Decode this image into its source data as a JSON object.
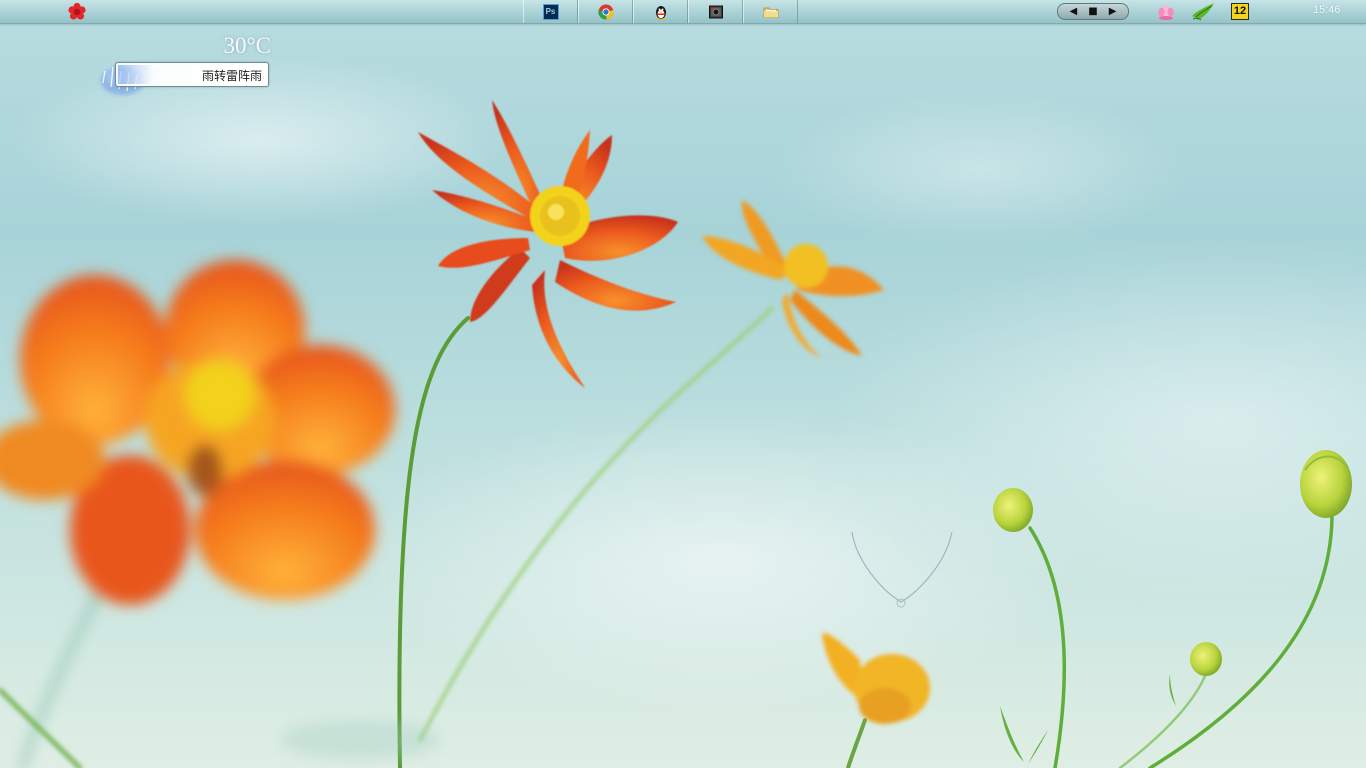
{
  "taskbar": {
    "start_icon": "red-flower-icon",
    "task_buttons": [
      {
        "name": "photoshop",
        "icon": "photoshop-icon",
        "label": "Ps"
      },
      {
        "name": "chrome",
        "icon": "chrome-icon"
      },
      {
        "name": "qq",
        "icon": "qq-penguin-icon"
      },
      {
        "name": "camera-app",
        "icon": "camera-icon"
      },
      {
        "name": "file-explorer",
        "icon": "folder-icon"
      }
    ],
    "media": {
      "prev": "◀",
      "stop": "■",
      "next": "▶"
    },
    "tray": {
      "lotus_icon": "lotus-icon",
      "bird_icon": "green-bird-icon",
      "calendar_day": "12"
    },
    "clock": "15:46"
  },
  "weather": {
    "temperature": "30°C",
    "description": "雨转雷阵雨",
    "icon": "rain-cloud-icon"
  },
  "colors": {
    "taskbar_top": "#c7e4e6",
    "taskbar_bottom": "#95c3c8",
    "sky": "#a7d3d8",
    "petal_orange": "#f07a1c",
    "petal_red": "#e24a1c",
    "stem_green": "#5fae3a"
  }
}
